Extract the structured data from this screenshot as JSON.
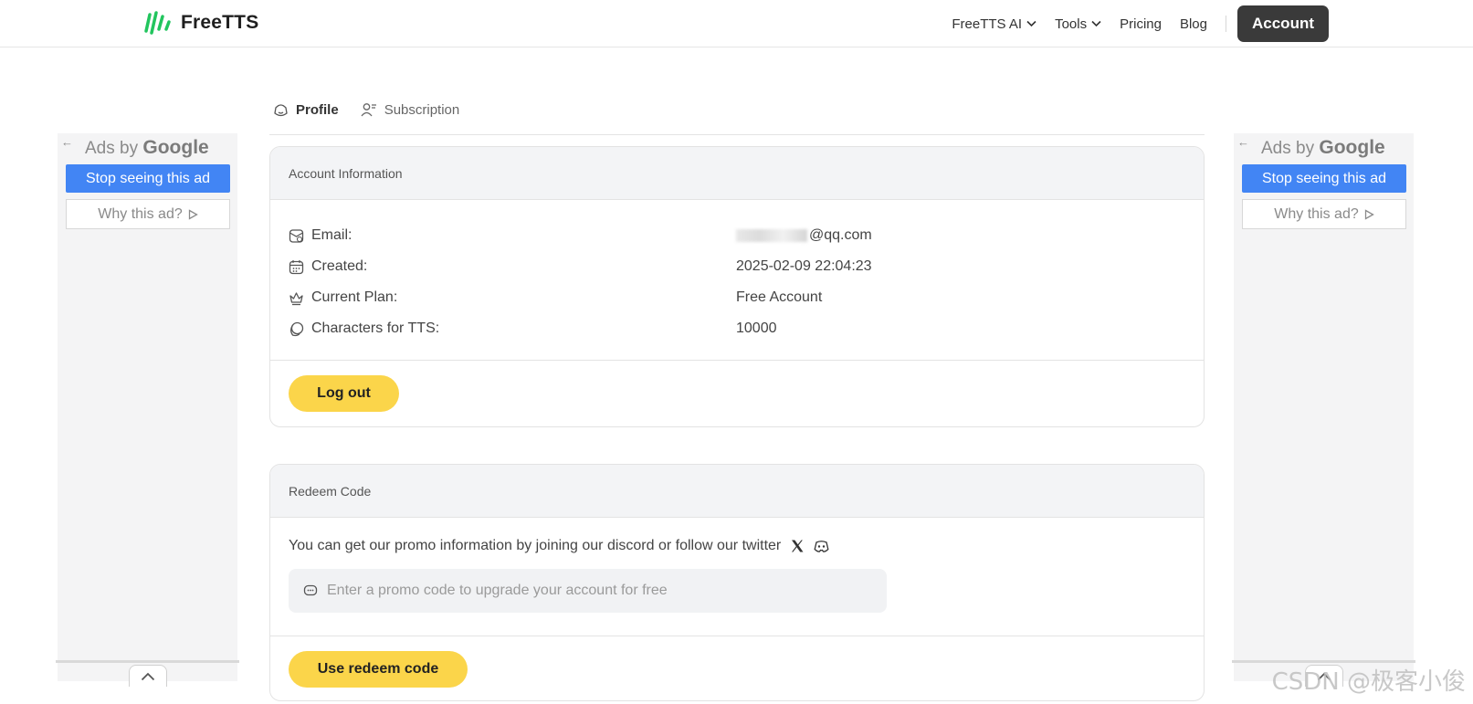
{
  "header": {
    "brand": "FreeTTS",
    "brand_color": "#22c55e",
    "nav": [
      {
        "label": "FreeTTS AI",
        "dropdown": true
      },
      {
        "label": "Tools",
        "dropdown": true
      },
      {
        "label": "Pricing",
        "dropdown": false
      },
      {
        "label": "Blog",
        "dropdown": false
      }
    ],
    "account_label": "Account"
  },
  "ads": {
    "ads_by": "Ads by",
    "google": "Google",
    "stop": "Stop seeing this ad",
    "why": "Why this ad?"
  },
  "tabs": [
    {
      "label": "Profile",
      "icon": "smile-face-icon",
      "active": true
    },
    {
      "label": "Subscription",
      "icon": "user-list-icon",
      "active": false
    }
  ],
  "account": {
    "title": "Account Information",
    "rows": [
      {
        "icon": "mail-icon",
        "label": "Email:",
        "value": "@qq.com",
        "obscured": true
      },
      {
        "icon": "calendar-icon",
        "label": "Created:",
        "value": "2025-02-09 22:04:23"
      },
      {
        "icon": "crown-icon",
        "label": "Current Plan:",
        "value": "Free Account"
      },
      {
        "icon": "chat-bubbles-icon",
        "label": "Characters for TTS:",
        "value": "10000"
      }
    ],
    "logout_label": "Log out"
  },
  "redeem": {
    "title": "Redeem Code",
    "promo_text": "You can get our promo information by joining our discord or follow our twitter",
    "input_placeholder": "Enter a promo code to upgrade your account for free",
    "button_label": "Use redeem code"
  },
  "watermark": "CSDN @极客小俊",
  "colors": {
    "accent_yellow": "#fbd54a",
    "account_btn": "#3a3a3a",
    "ad_blue": "#4285f4"
  }
}
